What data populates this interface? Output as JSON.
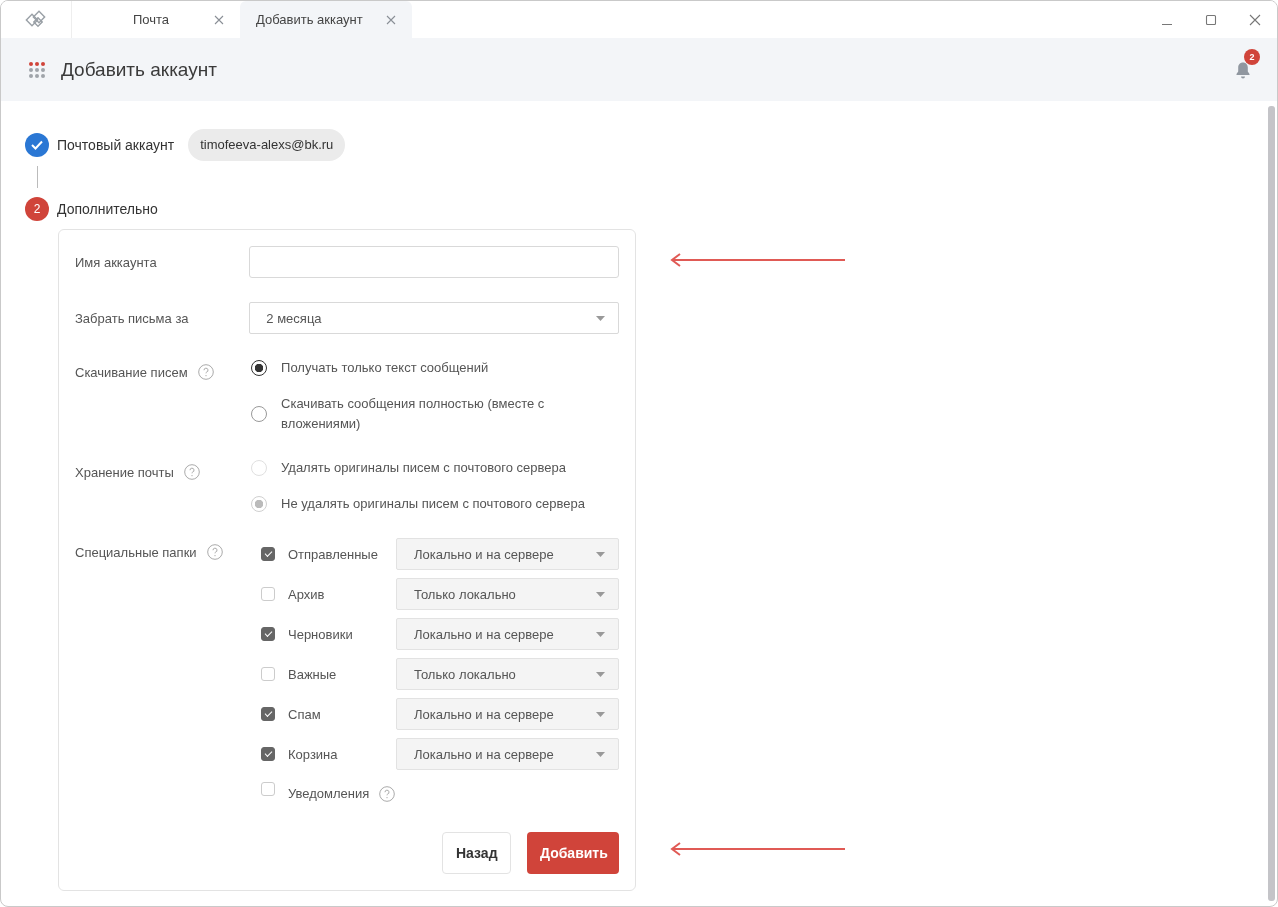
{
  "tabs": [
    {
      "label": "Почта",
      "selected": false
    },
    {
      "label": "Добавить аккаунт",
      "selected": true
    }
  ],
  "header": {
    "title": "Добавить аккаунт",
    "notifications": "2"
  },
  "steps": [
    {
      "label": "Почтовый аккаунт",
      "done": true,
      "chip": "timofeeva-alexs@bk.ru"
    },
    {
      "number": "2",
      "label": "Дополнительно",
      "done": false
    }
  ],
  "form": {
    "account_name": {
      "label": "Имя аккаунта"
    },
    "fetch_period": {
      "label": "Забрать письма за",
      "value": "2 месяца"
    },
    "download": {
      "label": "Скачивание писем",
      "disabled": false,
      "options": [
        {
          "label": "Получать только текст сообщений",
          "selected": true
        },
        {
          "label": "Скачивать сообщения полностью (вместе с вложениями)",
          "selected": false
        }
      ]
    },
    "storage": {
      "label": "Хранение почты",
      "disabled": true,
      "options": [
        {
          "label": "Удалять оригиналы писем с почтового сервера",
          "selected": false
        },
        {
          "label": "Не удалять оригиналы писем с почтового сервера",
          "selected": true
        }
      ]
    },
    "folders": {
      "label": "Специальные папки",
      "items": [
        {
          "name": "Отправленные",
          "checked": true,
          "mode": "Локально и на сервере"
        },
        {
          "name": "Архив",
          "checked": false,
          "mode": "Только локально"
        },
        {
          "name": "Черновики",
          "checked": true,
          "mode": "Локально и на сервере"
        },
        {
          "name": "Важные",
          "checked": false,
          "mode": "Только локально"
        },
        {
          "name": "Спам",
          "checked": true,
          "mode": "Локально и на сервере"
        },
        {
          "name": "Корзина",
          "checked": true,
          "mode": "Локально и на сервере"
        }
      ],
      "notifications": {
        "label": "Уведомления",
        "checked": false
      }
    },
    "buttons": {
      "back": "Назад",
      "add": "Добавить"
    }
  }
}
